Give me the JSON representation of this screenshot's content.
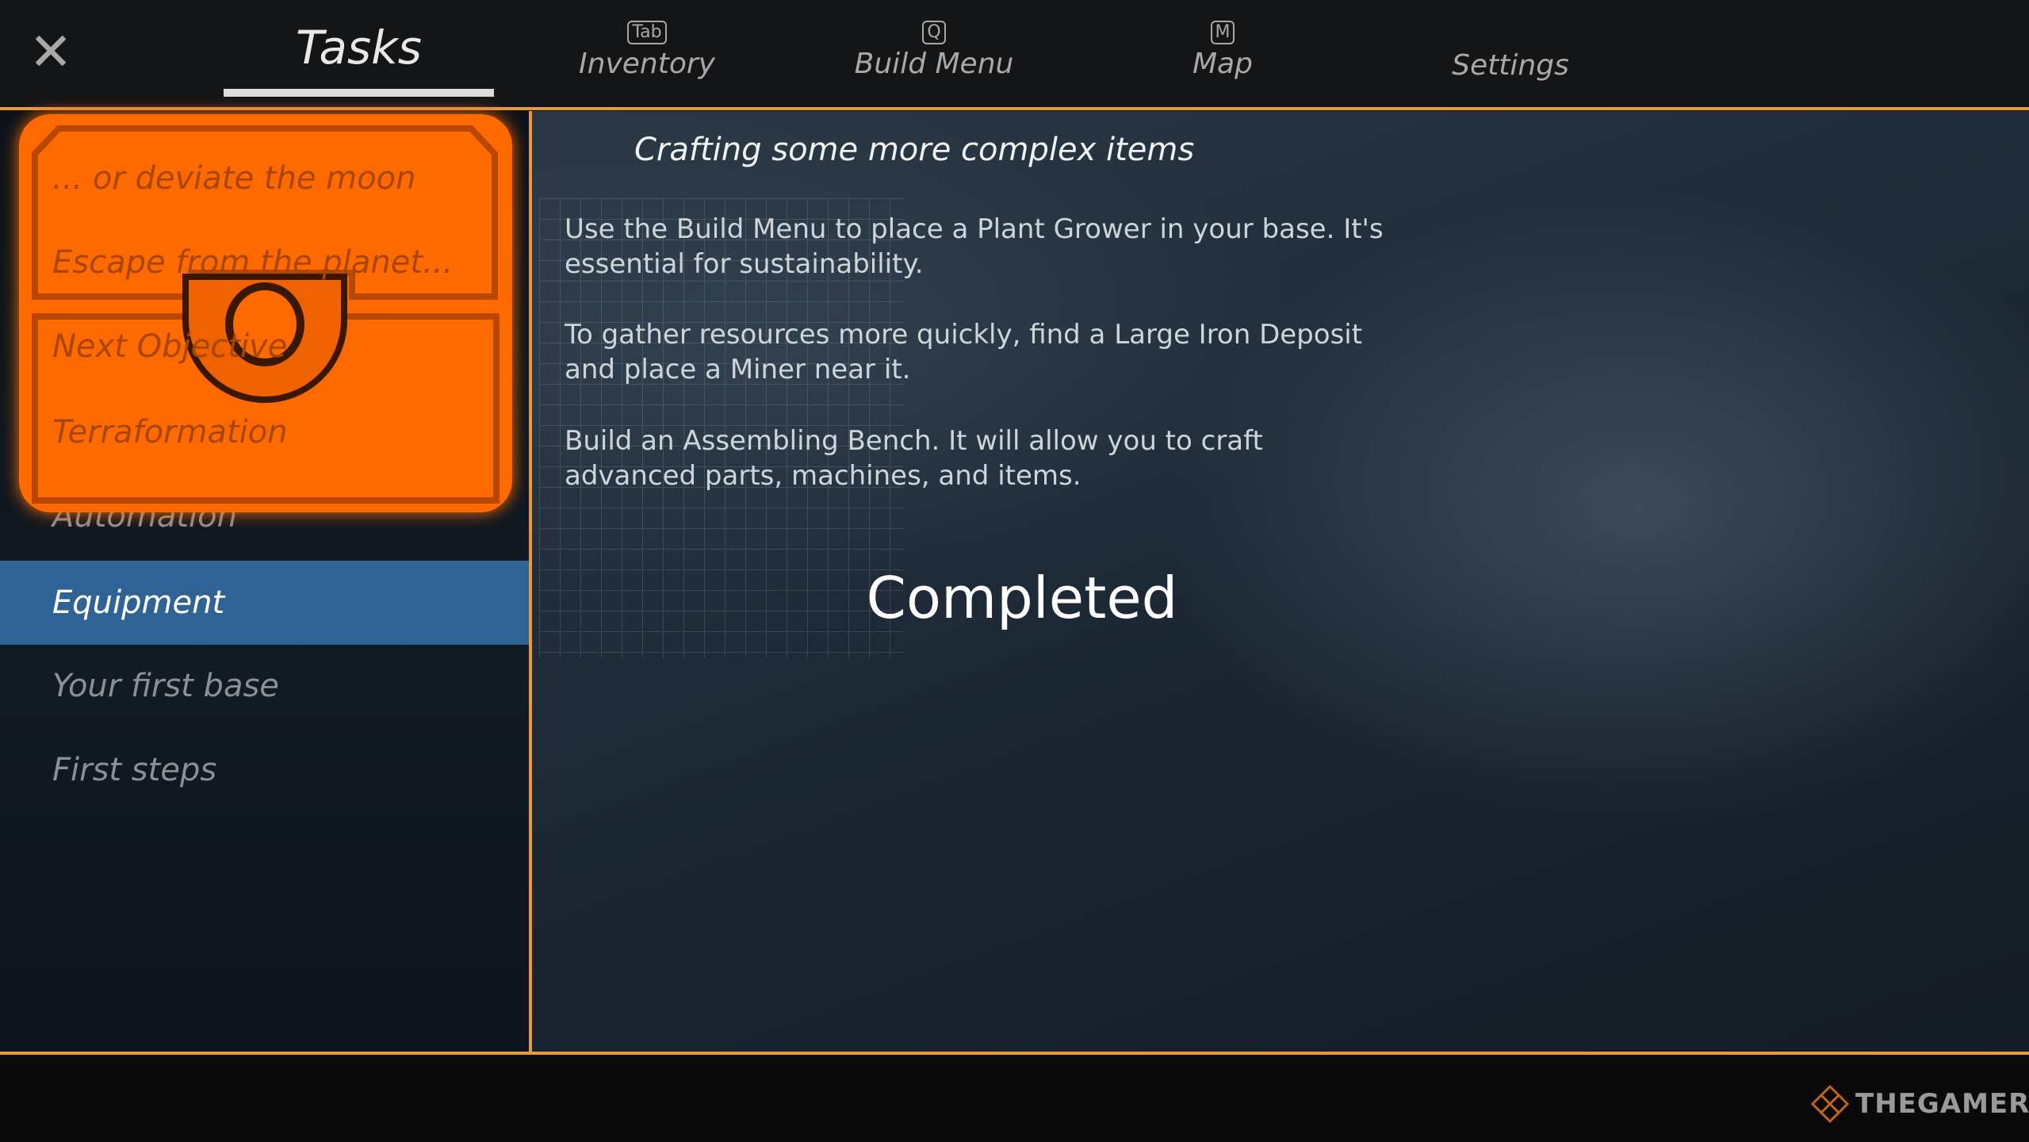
{
  "header": {
    "close_icon": "close-x-icon",
    "tabs": [
      {
        "label": "Tasks",
        "key": "",
        "active": true
      },
      {
        "label": "Inventory",
        "key": "Tab"
      },
      {
        "label": "Build Menu",
        "key": "Q"
      },
      {
        "label": "Map",
        "key": "M"
      },
      {
        "label": "Settings",
        "key": ""
      }
    ]
  },
  "sidebar": {
    "items": [
      {
        "label": "... or deviate the moon"
      },
      {
        "label": "Escape from the planet..."
      },
      {
        "label": "Next Objective"
      },
      {
        "label": "Terraformation"
      },
      {
        "label": "Automation"
      },
      {
        "label": "Equipment",
        "selected": true
      },
      {
        "label": "Your first base"
      },
      {
        "label": "First steps"
      }
    ],
    "overlay_icon": "treasure-chest-icon"
  },
  "main": {
    "title": "Crafting some more complex items",
    "paragraphs": [
      "Use the Build Menu to place a Plant Grower in your base. It's essential for sustainability.",
      "To gather resources more quickly, find a Large Iron Deposit and place a Miner near it.",
      "Build an Assembling Bench. It will allow you to craft advanced parts, machines, and items."
    ],
    "status": "Completed"
  },
  "watermark": {
    "text": "THEGAMER"
  },
  "colors": {
    "accent": "#e8993c",
    "selected": "#2f6396",
    "chest": "#ff6a00"
  }
}
